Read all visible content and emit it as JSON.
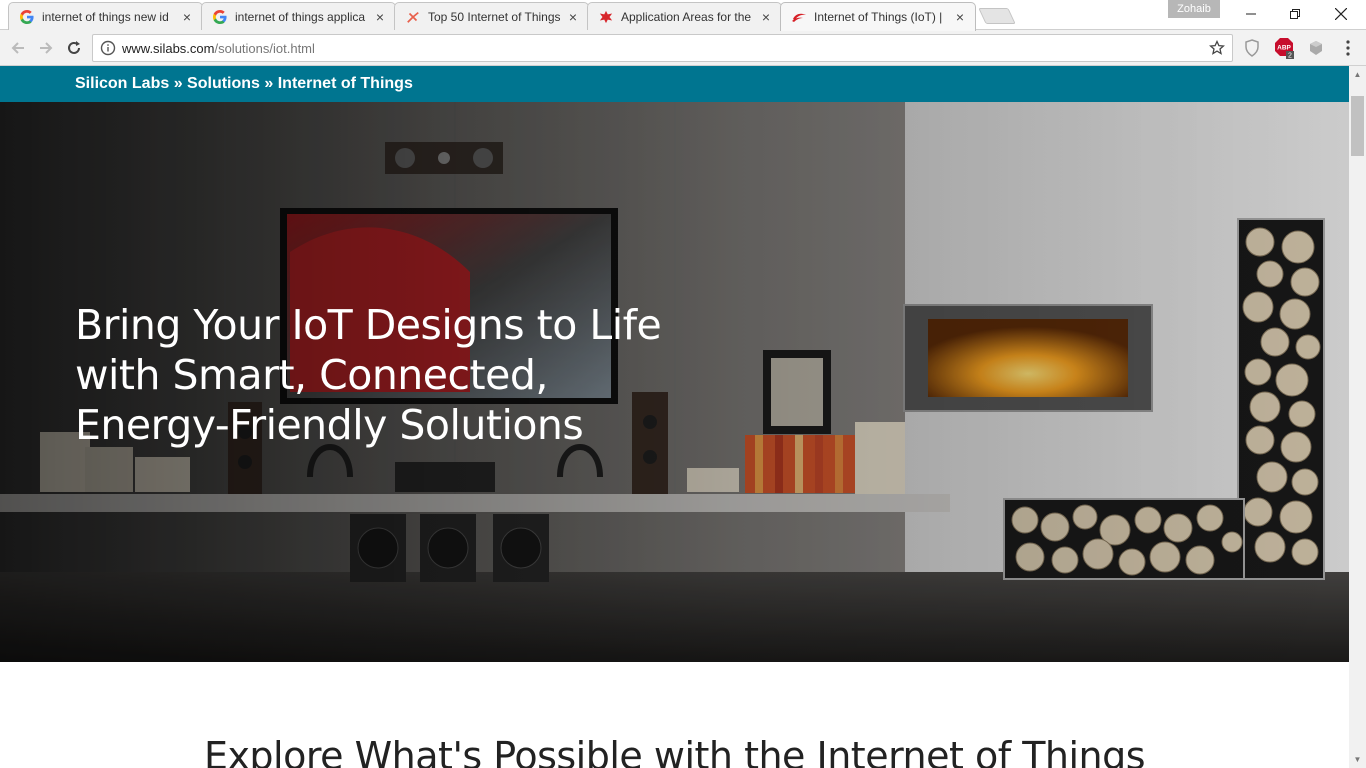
{
  "browser": {
    "tabs": [
      {
        "title": "internet of things new id",
        "favicon": "google-icon",
        "active": false
      },
      {
        "title": "internet of things applica",
        "favicon": "google-icon",
        "active": false
      },
      {
        "title": "Top 50 Internet of Things",
        "favicon": "star-burst-icon",
        "active": false
      },
      {
        "title": "Application Areas for the",
        "favicon": "red-leaf-icon",
        "active": false
      },
      {
        "title": "Internet of Things (IoT) | ",
        "favicon": "silabs-icon",
        "active": true
      }
    ],
    "profile_name": "Zohaib",
    "url_host": "www.silabs.com",
    "url_path": "/solutions/iot.html",
    "extensions": [
      "adblock-shield-icon",
      "abp-icon",
      "cast-icon"
    ],
    "abp_badge": "2"
  },
  "page": {
    "breadcrumb": [
      "Silicon Labs",
      "Solutions",
      "Internet of Things"
    ],
    "breadcrumb_sep": " » ",
    "hero_title_lines": [
      "Bring Your IoT Designs to Life",
      "with Smart, Connected,",
      "Energy-Friendly Solutions"
    ],
    "section_heading": "Explore What's Possible with the Internet of Things"
  },
  "colors": {
    "brand_bar": "#007590",
    "fire": "#f4a020"
  }
}
